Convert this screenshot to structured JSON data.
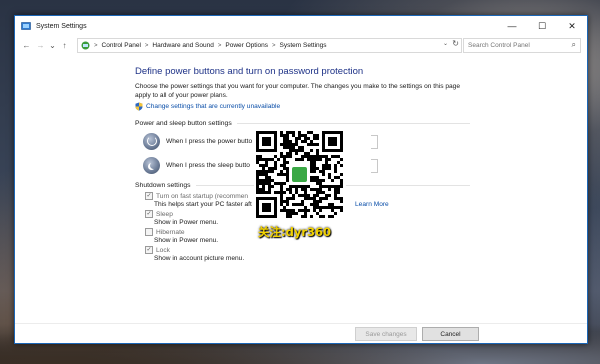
{
  "window": {
    "title": "System Settings",
    "caption": {
      "minimize": "—",
      "maximize": "☐",
      "close": "✕"
    }
  },
  "nav": {
    "back": "←",
    "forward": "→",
    "recent": "⌄",
    "up": "↑"
  },
  "breadcrumb": {
    "items": [
      "Control Panel",
      "Hardware and Sound",
      "Power Options",
      "System Settings"
    ],
    "separator": ">"
  },
  "search": {
    "placeholder": "Search Control Panel"
  },
  "main": {
    "heading": "Define power buttons and turn on password protection",
    "description": "Choose the power settings that you want for your computer. The changes you make to the settings on this page apply to all of your power plans.",
    "change_link": "Change settings that are currently unavailable",
    "power_section_title": "Power and sleep button settings",
    "power_button_label": "When I press the power butto",
    "sleep_button_label": "When I press the sleep butto",
    "shutdown_section_title": "Shutdown settings",
    "options": [
      {
        "label": "Turn on fast startup (recommen",
        "checked": true,
        "desc": "This helps start your PC faster aft"
      },
      {
        "label": "Sleep",
        "checked": true,
        "desc": "Show in Power menu."
      },
      {
        "label": "Hibernate",
        "checked": false,
        "desc": "Show in Power menu."
      },
      {
        "label": "Lock",
        "checked": true,
        "desc": "Show in account picture menu."
      }
    ],
    "learn_more": "Learn More"
  },
  "buttons": {
    "save": "Save changes",
    "cancel": "Cancel"
  },
  "watermark": {
    "text": "关注:dyr360"
  },
  "colors": {
    "heading": "#1e3287",
    "link": "#0a4ea8",
    "window_border": "#1b66b6",
    "watermark": "#f2d200"
  }
}
